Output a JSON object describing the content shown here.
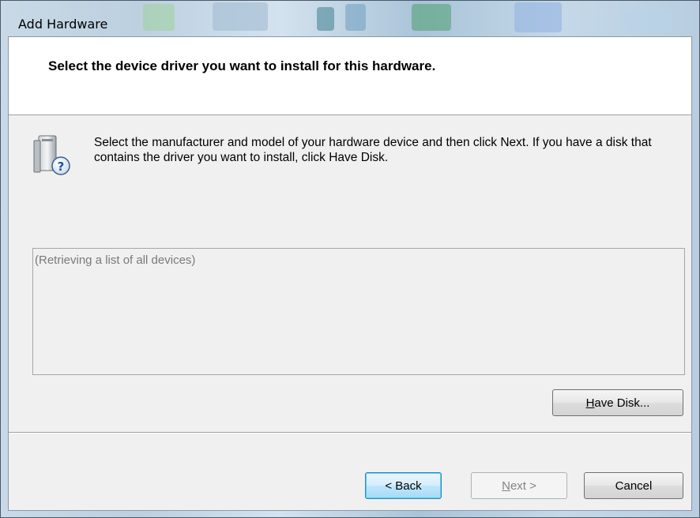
{
  "window": {
    "title": "Add Hardware"
  },
  "header": {
    "heading": "Select the device driver you want to install for this hardware."
  },
  "body": {
    "instruction": "Select the manufacturer and model of your hardware device and then click Next. If you have a disk that contains the driver you want to install, click Have Disk.",
    "icon": "hardware-question-icon"
  },
  "device_list": {
    "placeholder": "(Retrieving a list of all devices)"
  },
  "buttons": {
    "have_disk_mnemonic": "H",
    "have_disk_rest": "ave Disk...",
    "back": "< Back",
    "next_mnemonic": "N",
    "next_rest": "ext >",
    "cancel": "Cancel"
  },
  "colors": {
    "default_button_border": "#3c7fb1",
    "disabled_text": "#838383",
    "placeholder_text": "#7a7a7a"
  }
}
